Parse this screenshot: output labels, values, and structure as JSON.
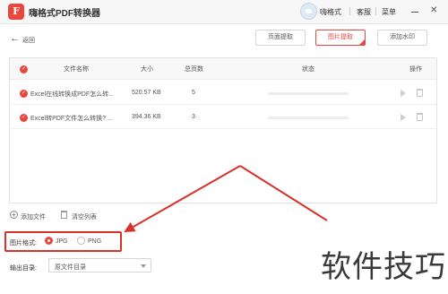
{
  "titlebar": {
    "app_title": "嗨格式PDF转换器",
    "user_name": "嗨格式",
    "service_label": "客服",
    "menu_label": "菜单",
    "minimize_glyph": "—",
    "close_glyph": "✕",
    "logo_glyph": "F"
  },
  "toolbar": {
    "back_label": "返回",
    "tabs": [
      {
        "label": "页面提取",
        "active": false
      },
      {
        "label": "图片提取",
        "active": true
      },
      {
        "label": "添加水印",
        "active": false
      }
    ]
  },
  "table": {
    "columns": [
      "文件名称",
      "大小",
      "总页数",
      "状态",
      "操作"
    ],
    "rows": [
      {
        "name": "Excel在线转换成PDF怎么转...",
        "size": "520.57 KB",
        "pages": "5",
        "progress": 0
      },
      {
        "name": "Excel转PDF文件怎么转换? ...",
        "size": "394.36 KB",
        "pages": "3",
        "progress": 0
      }
    ]
  },
  "actions": {
    "add_file_label": "添加文件",
    "clear_list_label": "清空列表"
  },
  "format": {
    "label": "图片格式:",
    "options": [
      {
        "label": "JPG",
        "checked": true
      },
      {
        "label": "PNG",
        "checked": false
      }
    ]
  },
  "output": {
    "label": "输出目录:",
    "value": "原文件目录"
  },
  "watermark": {
    "text": "软件技巧"
  },
  "colors": {
    "accent": "#e8473f",
    "annotation": "#d8322b"
  },
  "icons": {
    "logo": "app-logo-icon",
    "back": "arrow-left-icon",
    "check": "check-circle-icon",
    "play": "play-icon",
    "delete": "trash-icon",
    "add": "plus-circle-icon",
    "clear": "trash-icon",
    "caret": "chevron-down-icon"
  }
}
